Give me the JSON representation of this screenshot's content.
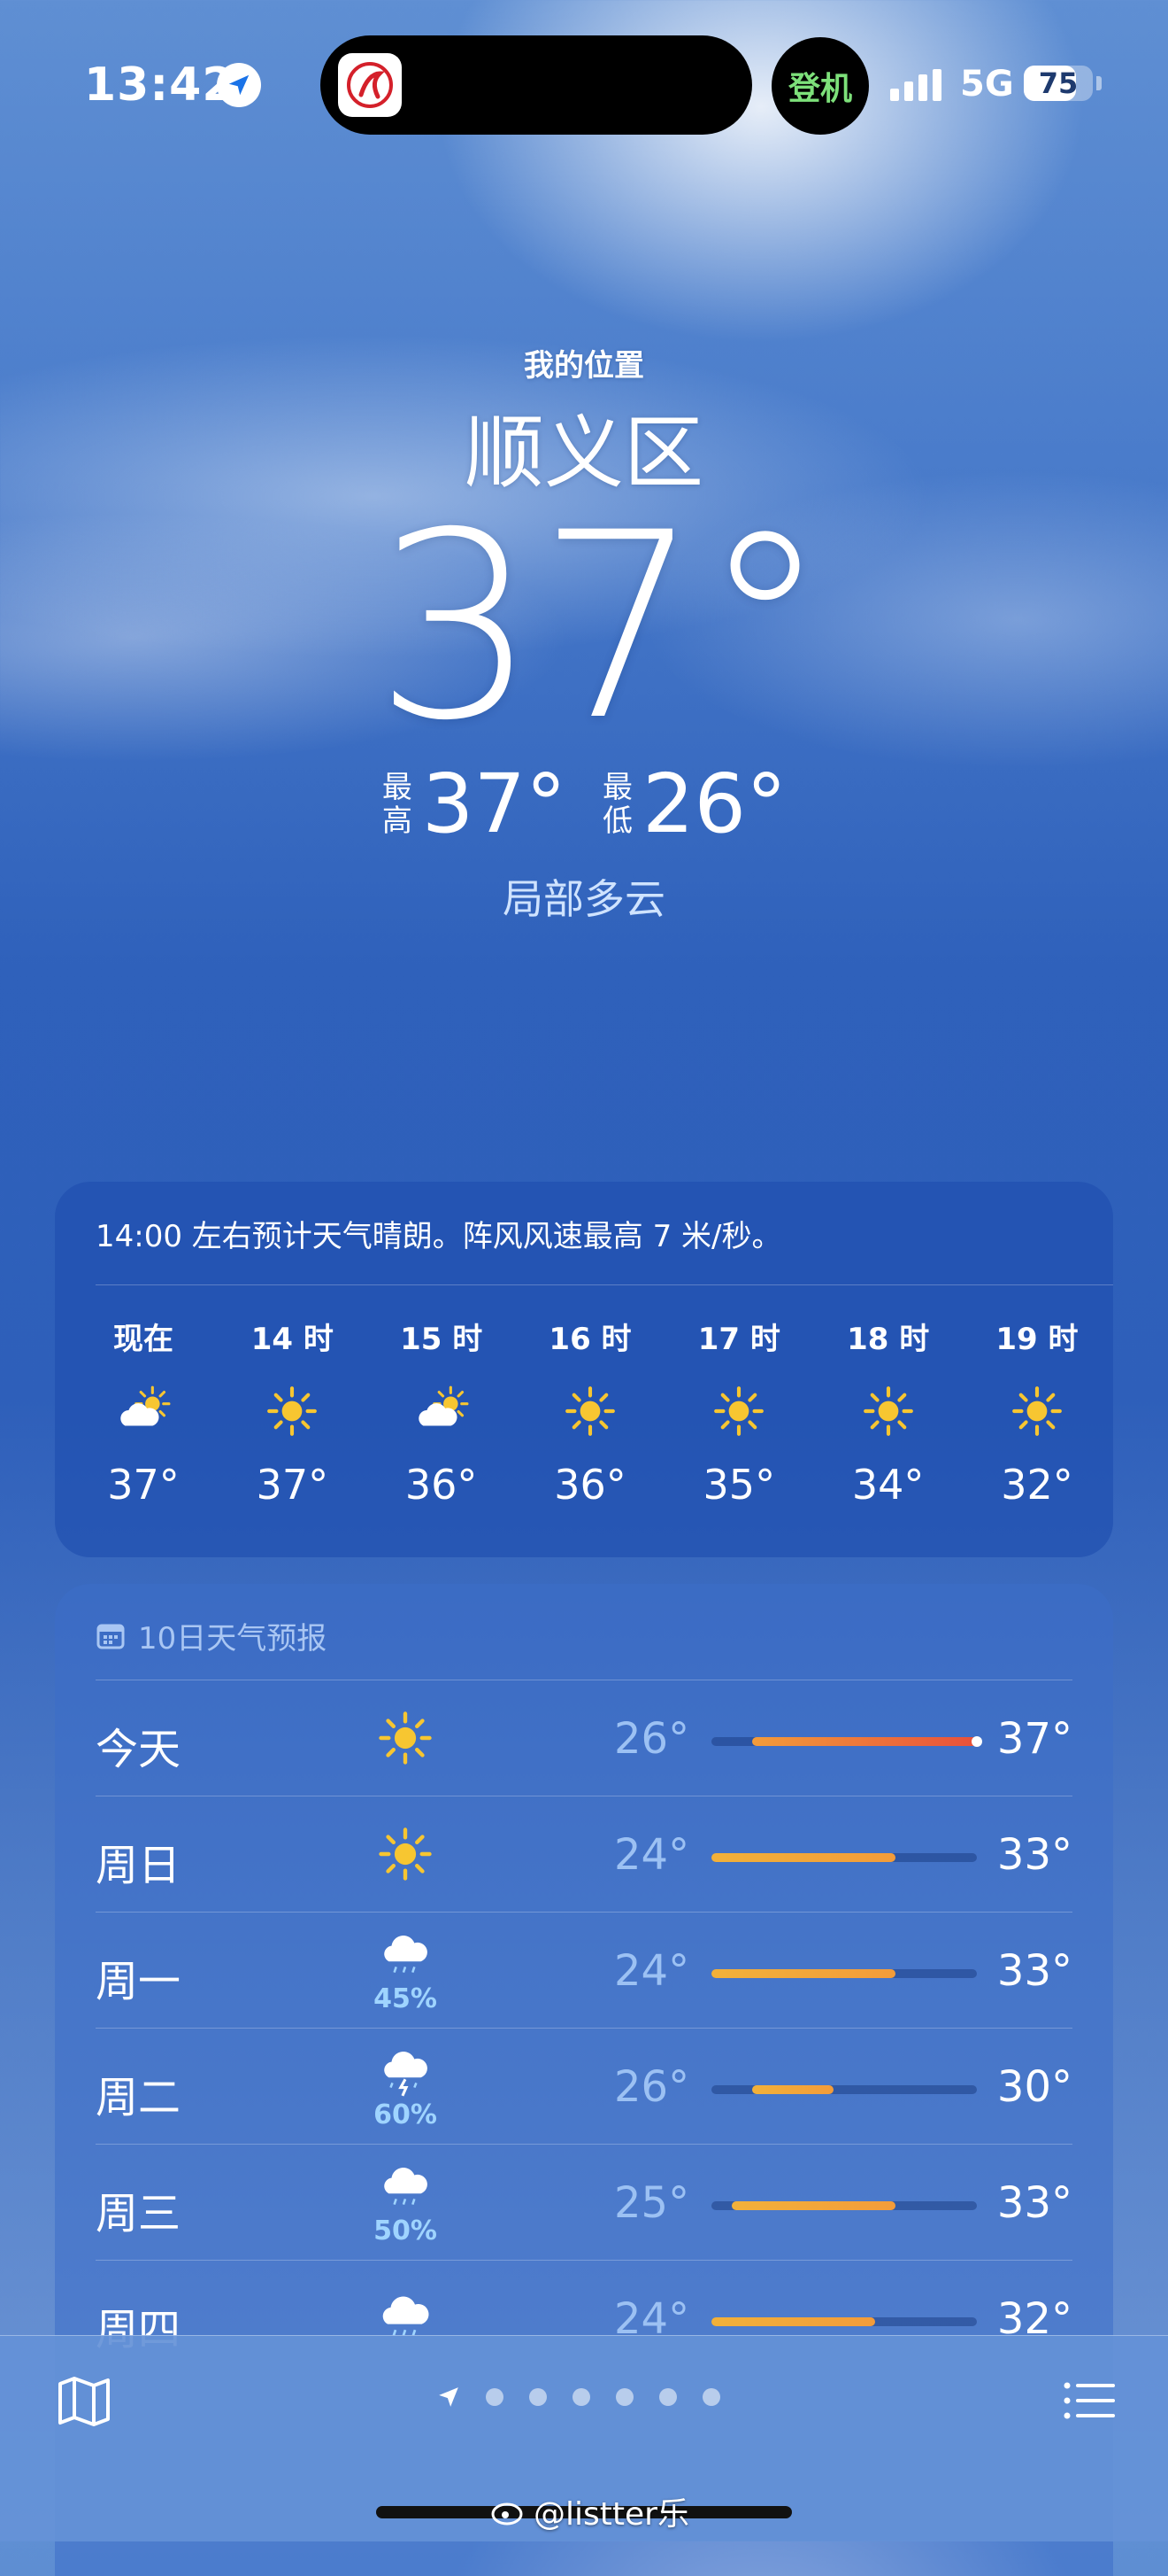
{
  "status": {
    "time": "13:42",
    "island_pill": "登机",
    "network": "5G",
    "battery": "75",
    "battery_level": 0.75
  },
  "header": {
    "location_label": "我的位置",
    "city": "顺义区",
    "temperature": "37°",
    "high_label": "最高",
    "high": "37°",
    "low_label": "最低",
    "low": "26°",
    "condition": "局部多云"
  },
  "hourly": {
    "summary": "14:00 左右预计天气晴朗。阵风风速最高 7 米/秒。",
    "hours": [
      {
        "label": "现在",
        "icon": "partly-cloudy-icon",
        "temp": "37°"
      },
      {
        "label": "14 时",
        "icon": "sun-icon",
        "temp": "37°"
      },
      {
        "label": "15 时",
        "icon": "partly-cloudy-icon",
        "temp": "36°"
      },
      {
        "label": "16 时",
        "icon": "sun-icon",
        "temp": "36°"
      },
      {
        "label": "17 时",
        "icon": "sun-icon",
        "temp": "35°"
      },
      {
        "label": "18 时",
        "icon": "sun-icon",
        "temp": "34°"
      },
      {
        "label": "19 时",
        "icon": "sun-icon",
        "temp": "32°"
      }
    ]
  },
  "daily": {
    "title": "10日天气预报",
    "range_min": 24,
    "range_max": 37,
    "days": [
      {
        "name": "今天",
        "icon": "sun-icon",
        "precip": "",
        "low": "26°",
        "high": "37°",
        "low_val": 26,
        "high_val": 37,
        "current_val": 37
      },
      {
        "name": "周日",
        "icon": "sun-icon",
        "precip": "",
        "low": "24°",
        "high": "33°",
        "low_val": 24,
        "high_val": 33
      },
      {
        "name": "周一",
        "icon": "rain-cloud-icon",
        "precip": "45%",
        "low": "24°",
        "high": "33°",
        "low_val": 24,
        "high_val": 33
      },
      {
        "name": "周二",
        "icon": "thunder-cloud-icon",
        "precip": "60%",
        "low": "26°",
        "high": "30°",
        "low_val": 26,
        "high_val": 30
      },
      {
        "name": "周三",
        "icon": "rain-cloud-icon",
        "precip": "50%",
        "low": "25°",
        "high": "33°",
        "low_val": 25,
        "high_val": 33
      },
      {
        "name": "周四",
        "icon": "rain-cloud-icon",
        "precip": "",
        "low": "24°",
        "high": "32°",
        "low_val": 24,
        "high_val": 32
      }
    ]
  },
  "bottom": {
    "watermark": "@listter乐",
    "page_count": 6
  },
  "colors": {
    "sun": "#f7c631",
    "bar_warm": "#f39c3a",
    "bar_hot": "#e8503a",
    "island_accent": "#7de07a"
  }
}
